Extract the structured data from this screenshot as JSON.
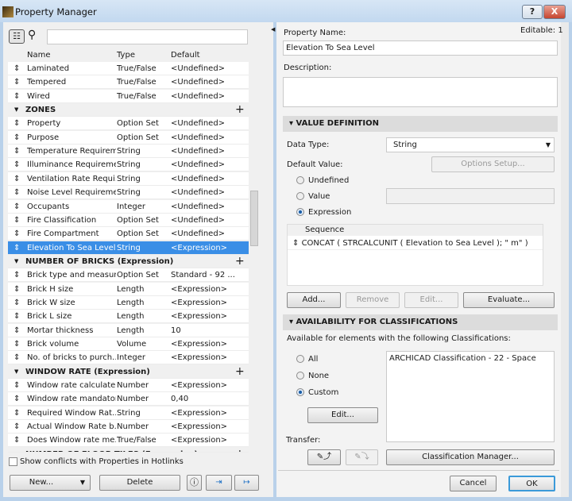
{
  "window": {
    "title": "Property Manager",
    "help": "?",
    "close": "X"
  },
  "left": {
    "search_placeholder": "",
    "columns": [
      "Name",
      "Type",
      "Default"
    ],
    "rows": [
      {
        "kind": "item",
        "name": "Laminated",
        "type": "True/False",
        "default": "<Undefined>"
      },
      {
        "kind": "item",
        "name": "Tempered",
        "type": "True/False",
        "default": "<Undefined>"
      },
      {
        "kind": "item",
        "name": "Wired",
        "type": "True/False",
        "default": "<Undefined>"
      },
      {
        "kind": "group",
        "name": "ZONES"
      },
      {
        "kind": "item",
        "name": "Property",
        "type": "Option Set",
        "default": "<Undefined>"
      },
      {
        "kind": "item",
        "name": "Purpose",
        "type": "Option Set",
        "default": "<Undefined>"
      },
      {
        "kind": "item",
        "name": "Temperature Requirem...",
        "type": "String",
        "default": "<Undefined>"
      },
      {
        "kind": "item",
        "name": "Illuminance Requireme...",
        "type": "String",
        "default": "<Undefined>"
      },
      {
        "kind": "item",
        "name": "Ventilation Rate Requi...",
        "type": "String",
        "default": "<Undefined>"
      },
      {
        "kind": "item",
        "name": "Noise Level Requirement",
        "type": "String",
        "default": "<Undefined>"
      },
      {
        "kind": "item",
        "name": "Occupants",
        "type": "Integer",
        "default": "<Undefined>"
      },
      {
        "kind": "item",
        "name": "Fire Classification",
        "type": "Option Set",
        "default": "<Undefined>"
      },
      {
        "kind": "item",
        "name": "Fire Compartment",
        "type": "Option Set",
        "default": "<Undefined>"
      },
      {
        "kind": "item",
        "name": "Elevation To Sea Level",
        "type": "String",
        "default": "<Expression>",
        "selected": true
      },
      {
        "kind": "group",
        "name": "NUMBER OF BRICKS (Expression)"
      },
      {
        "kind": "item",
        "name": "Brick type and measures",
        "type": "Option Set",
        "default": "Standard - 92 ..."
      },
      {
        "kind": "item",
        "name": "Brick H size",
        "type": "Length",
        "default": "<Expression>"
      },
      {
        "kind": "item",
        "name": "Brick W size",
        "type": "Length",
        "default": "<Expression>"
      },
      {
        "kind": "item",
        "name": "Brick L size",
        "type": "Length",
        "default": "<Expression>"
      },
      {
        "kind": "item",
        "name": "Mortar thickness",
        "type": "Length",
        "default": "10"
      },
      {
        "kind": "item",
        "name": "Brick volume",
        "type": "Volume",
        "default": "<Expression>"
      },
      {
        "kind": "item",
        "name": "No. of bricks to purch...",
        "type": "Integer",
        "default": "<Expression>"
      },
      {
        "kind": "group",
        "name": "WINDOW RATE (Expression)"
      },
      {
        "kind": "item",
        "name": "Window rate calculated",
        "type": "Number",
        "default": "<Expression>"
      },
      {
        "kind": "item",
        "name": "Window rate mandatory",
        "type": "Number",
        "default": "0,40"
      },
      {
        "kind": "item",
        "name": "Required Window Rat...",
        "type": "String",
        "default": "<Expression>"
      },
      {
        "kind": "item",
        "name": "Actual Window Rate b...",
        "type": "Number",
        "default": "<Expression>"
      },
      {
        "kind": "item",
        "name": "Does Window rate me...",
        "type": "True/False",
        "default": "<Expression>"
      },
      {
        "kind": "group",
        "name": "NUMBER OF FLOOR TILES (Expression)"
      }
    ],
    "show_conflicts": "Show conflicts with Properties in Hotlinks",
    "new_label": "New...",
    "delete_label": "Delete"
  },
  "right": {
    "property_name_label": "Property Name:",
    "editable": "Editable: 1",
    "property_name": "Elevation To Sea Level",
    "description_label": "Description:",
    "description": "",
    "value_definition": "VALUE DEFINITION",
    "data_type_label": "Data Type:",
    "data_type": "String",
    "default_value_label": "Default Value:",
    "options_setup": "Options Setup...",
    "radio_undefined": "Undefined",
    "radio_value": "Value",
    "radio_expression": "Expression",
    "sequence_header": "Sequence",
    "sequence_item": "CONCAT ( STRCALCUNIT ( Elevation to Sea Level ); \" m\" )",
    "add": "Add...",
    "remove": "Remove",
    "edit": "Edit...",
    "evaluate": "Evaluate...",
    "availability": "AVAILABILITY FOR CLASSIFICATIONS",
    "available_text": "Available for elements with the following Classifications:",
    "radio_all": "All",
    "radio_none": "None",
    "radio_custom": "Custom",
    "edit2": "Edit...",
    "classification": "ARCHICAD Classification - 22 - Space",
    "transfer_label": "Transfer:",
    "classification_manager": "Classification Manager...",
    "cancel": "Cancel",
    "ok": "OK"
  },
  "colors": {
    "selection": "#3a8ee6",
    "ok_border": "#3b9ad9"
  }
}
